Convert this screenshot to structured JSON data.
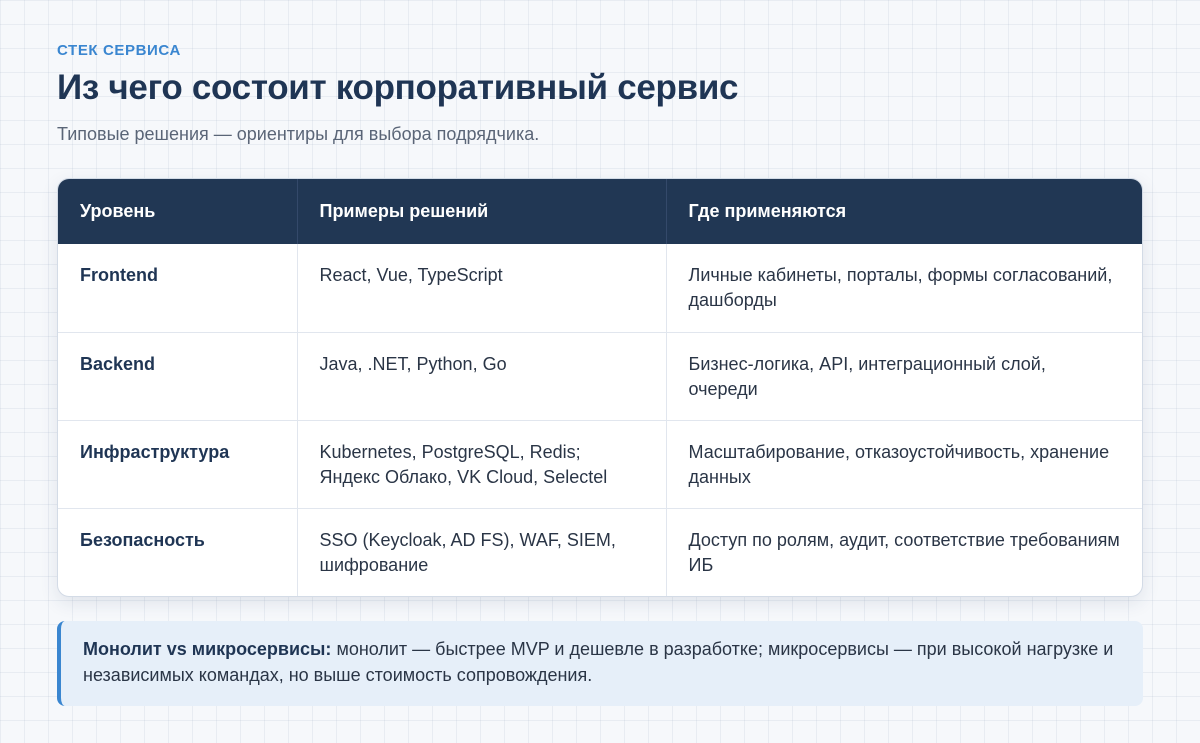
{
  "header": {
    "eyebrow": "СТЕК СЕРВИСА",
    "title": "Из чего состоит корпоративный сервис",
    "subtitle": "Типовые решения — ориентиры для выбора подрядчика."
  },
  "table": {
    "columns": [
      "Уровень",
      "Примеры решений",
      "Где применяются"
    ],
    "rows": [
      {
        "level": "Frontend",
        "examples": "React, Vue, TypeScript",
        "usage": "Личные кабинеты, порталы, формы согласований, дашборды"
      },
      {
        "level": "Backend",
        "examples": "Java, .NET, Python, Go",
        "usage": "Бизнес-логика, API, интеграционный слой, очереди"
      },
      {
        "level": "Инфраструктура",
        "examples": "Kubernetes, PostgreSQL, Redis; Яндекс Облако, VK Cloud, Selectel",
        "usage": "Масштабирование, отказоустойчивость, хранение данных"
      },
      {
        "level": "Безопасность",
        "examples": "SSO (Keycloak, AD FS), WAF, SIEM, шифрование",
        "usage": "Доступ по ролям, аудит, соответствие требованиям ИБ"
      }
    ]
  },
  "note": {
    "label": "Монолит vs микросервисы:",
    "text": "монолит — быстрее MVP и дешевле в разработке; микросервисы — при высокой нагрузке и независимых командах, но выше стоимость сопровождения."
  },
  "colors": {
    "accent": "#3a86d0",
    "header_bg": "#213754",
    "title": "#1f3554",
    "note_bg": "#e6eff9"
  }
}
